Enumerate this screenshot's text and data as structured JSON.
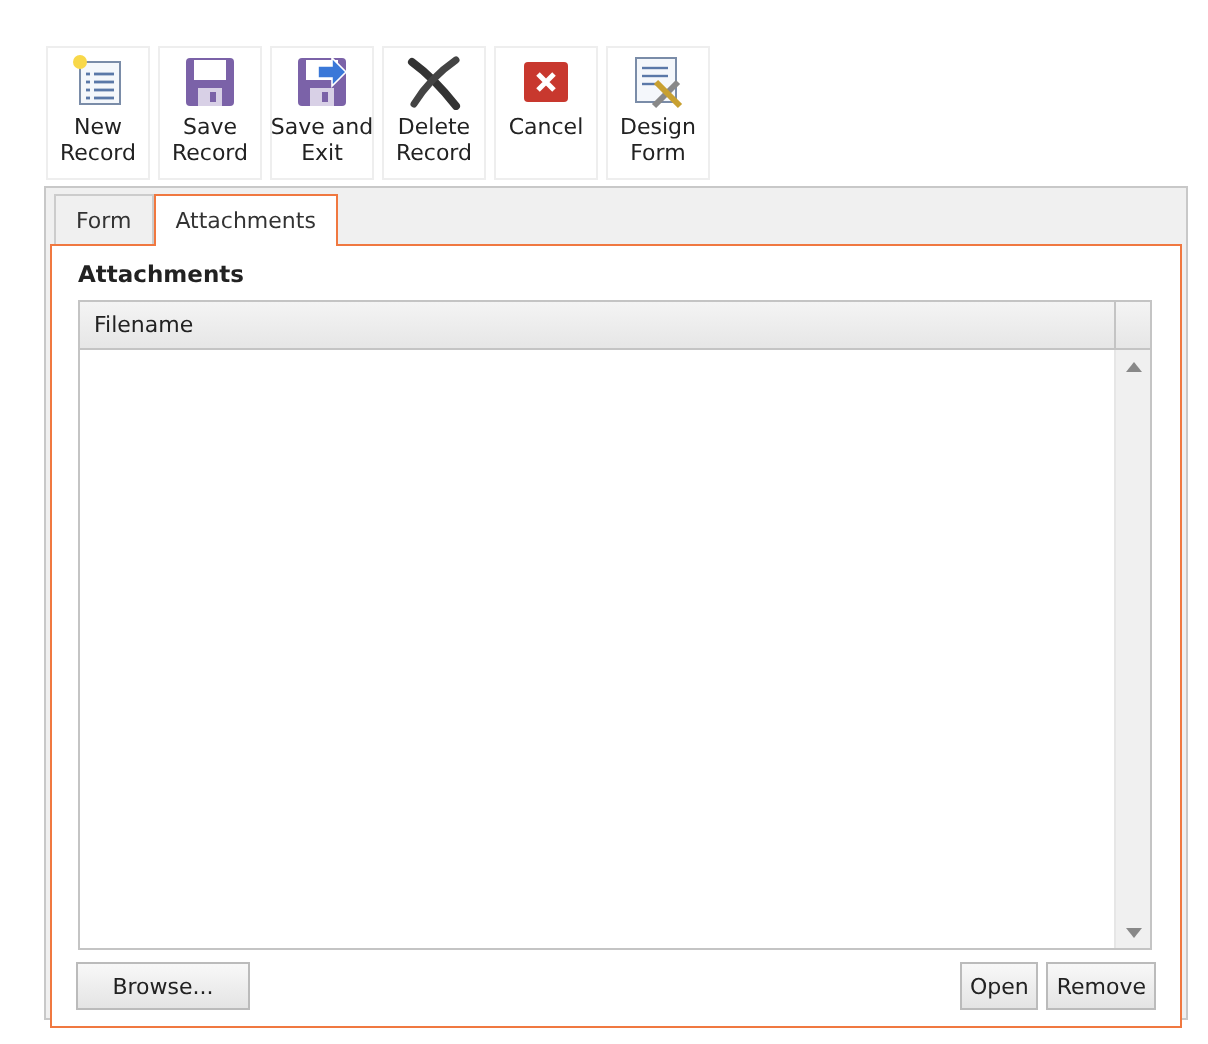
{
  "toolbar": [
    {
      "label": "New\nRecord",
      "kind": "new"
    },
    {
      "label": "Save\nRecord",
      "kind": "save"
    },
    {
      "label": "Save and\nExit",
      "kind": "save-exit"
    },
    {
      "label": "Delete\nRecord",
      "kind": "delete"
    },
    {
      "label": "Cancel",
      "kind": "cancel"
    },
    {
      "label": "Design\nForm",
      "kind": "design"
    }
  ],
  "tabs": [
    {
      "label": "Form",
      "selected": false
    },
    {
      "label": "Attachments",
      "selected": true
    }
  ],
  "section_title": "Attachments",
  "table": {
    "columns": [
      "Filename"
    ]
  },
  "buttons": {
    "left": [
      "Browse..."
    ],
    "right": [
      "Open",
      "Remove"
    ]
  }
}
